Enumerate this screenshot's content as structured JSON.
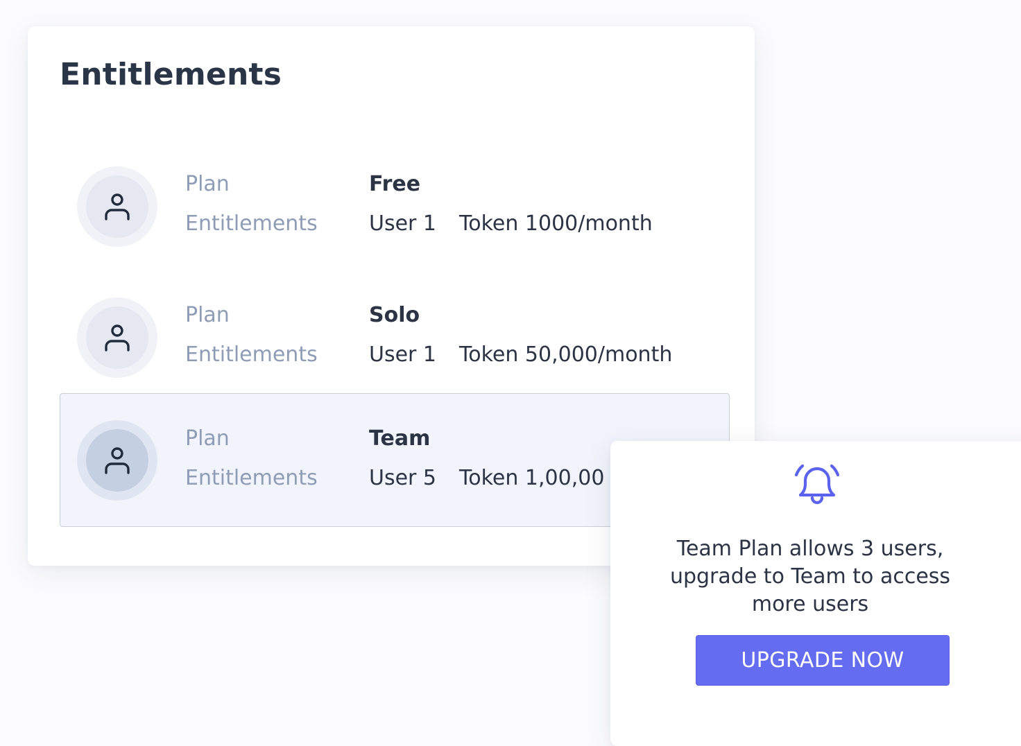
{
  "page_title": "Entitlements",
  "plans": [
    {
      "plan_label": "Plan",
      "plan_name": "Free",
      "entitlements_label": "Entitlements",
      "users": "User 1",
      "tokens": "Token 1000/month",
      "selected": false
    },
    {
      "plan_label": "Plan",
      "plan_name": "Solo",
      "entitlements_label": "Entitlements",
      "users": "User 1",
      "tokens": "Token 50,000/month",
      "selected": false
    },
    {
      "plan_label": "Plan",
      "plan_name": "Team",
      "entitlements_label": "Entitlements",
      "users": "User 5",
      "tokens": "Token 1,00,00",
      "selected": true
    }
  ],
  "popup": {
    "icon": "bell-icon",
    "message": "Team Plan allows 3 users, upgrade to Team to access more users",
    "button_label": "UPGRADE NOW"
  },
  "colors": {
    "accent": "#646cf2",
    "label_text": "#8e9cb6",
    "value_text": "#2b3345",
    "selected_row_bg": "#f1f4fb"
  }
}
